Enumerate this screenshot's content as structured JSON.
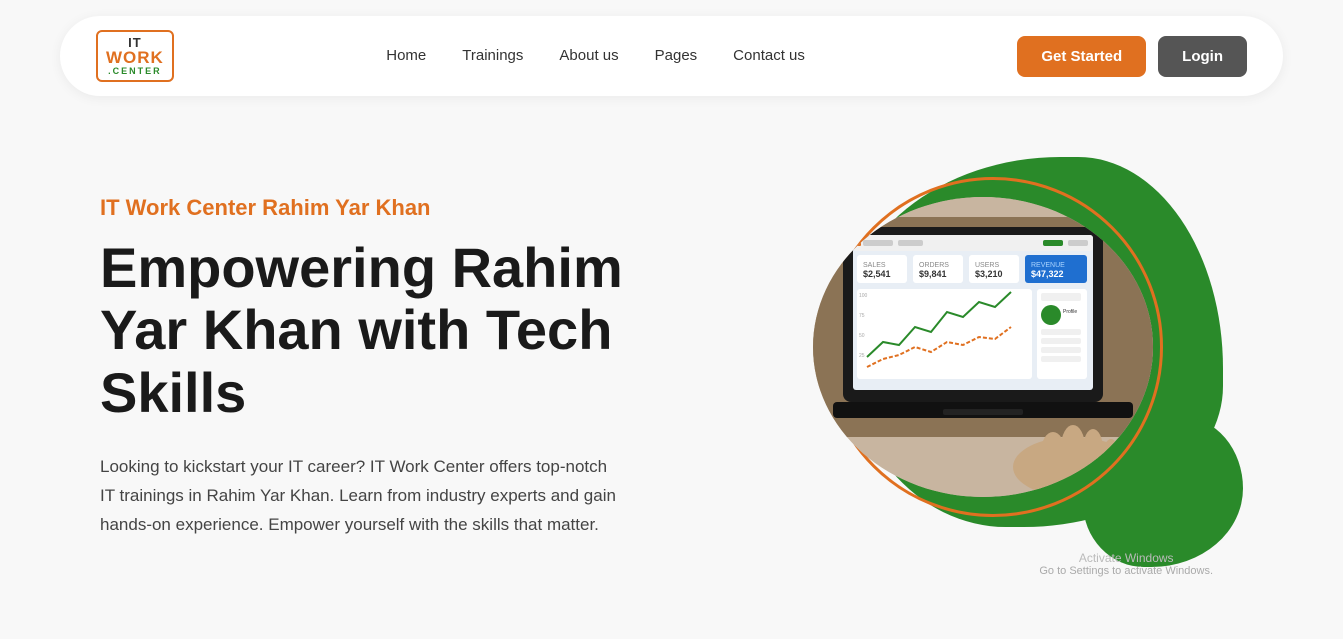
{
  "navbar": {
    "logo": {
      "it": "IT",
      "work": "WORK",
      "center": ".CENTER"
    },
    "links": [
      {
        "label": "Home",
        "id": "home"
      },
      {
        "label": "Trainings",
        "id": "trainings"
      },
      {
        "label": "About us",
        "id": "about"
      },
      {
        "label": "Pages",
        "id": "pages"
      },
      {
        "label": "Contact us",
        "id": "contact"
      }
    ],
    "get_started": "Get Started",
    "login": "Login"
  },
  "hero": {
    "subtitle": "IT Work Center Rahim Yar Khan",
    "title": "Empowering Rahim Yar Khan with Tech Skills",
    "description": "Looking to kickstart your IT career? IT Work Center offers top-notch IT trainings in Rahim Yar Khan. Learn from industry experts and gain hands-on experience. Empower yourself with the skills that matter."
  },
  "windows_notice": {
    "line1": "Activate Windows",
    "line2": "Go to Settings to activate Windows."
  },
  "colors": {
    "orange": "#e07020",
    "green": "#2a8a2a",
    "dark": "#1a1a1a",
    "gray": "#555"
  }
}
